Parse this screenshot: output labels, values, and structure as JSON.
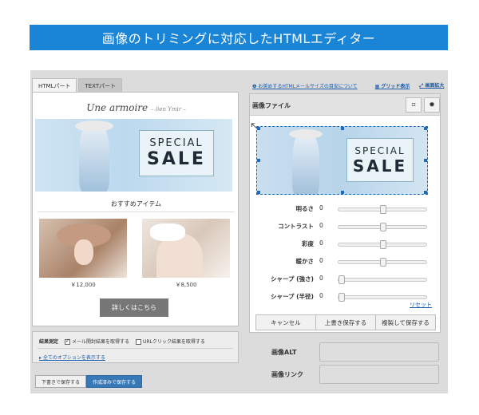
{
  "banner": {
    "title": "画像のトリミングに対応したHTMLエディター"
  },
  "tabs": [
    {
      "label": "HTMLパート"
    },
    {
      "label": "TEXTパート"
    }
  ],
  "preview": {
    "brand": "Une armoire",
    "brand_sub": "– lien Ymir –",
    "hero": {
      "line1": "SPECIAL",
      "line2": "SALE"
    },
    "section_title": "おすすめアイテム",
    "products": [
      {
        "price": "￥12,000"
      },
      {
        "price": "￥8,500"
      }
    ],
    "more_button": "詳しくはこちら"
  },
  "settings": {
    "label": "結果測定",
    "open_check": {
      "label": "メール開封結果を取得する",
      "checked": true
    },
    "click_check": {
      "label": "URLクリック結果を取得する",
      "checked": false
    },
    "options_link": "全てのオプションを表示する"
  },
  "bottom_buttons": {
    "overwrite": "下書きで保存する",
    "save_done": "作成済みで保存する"
  },
  "toplinks": {
    "help": "お奨めするHTMLメールサイズの目安について",
    "grid": "グリッド表示",
    "zoom": "画面拡大"
  },
  "image_panel": {
    "title": "画像ファイル",
    "hero": {
      "line1": "SPECIAL",
      "line2": "SALE"
    },
    "sliders": [
      {
        "label": "明るさ",
        "value": "0",
        "position": 0.5
      },
      {
        "label": "コントラスト",
        "value": "0",
        "position": 0.5
      },
      {
        "label": "彩度",
        "value": "0",
        "position": 0.5
      },
      {
        "label": "暖かさ",
        "value": "0",
        "position": 0.5
      },
      {
        "label": "シャープ (強さ)",
        "value": "0",
        "position": 0.0
      },
      {
        "label": "シャープ (半径)",
        "value": "0",
        "position": 0.0
      }
    ],
    "reset": "リセット",
    "actions": {
      "cancel": "キャンセル",
      "overwrite": "上書き保存する",
      "duplicate": "複製して保存する"
    }
  },
  "fields": {
    "alt_label": "画像ALT",
    "link_label": "画像リンク"
  }
}
